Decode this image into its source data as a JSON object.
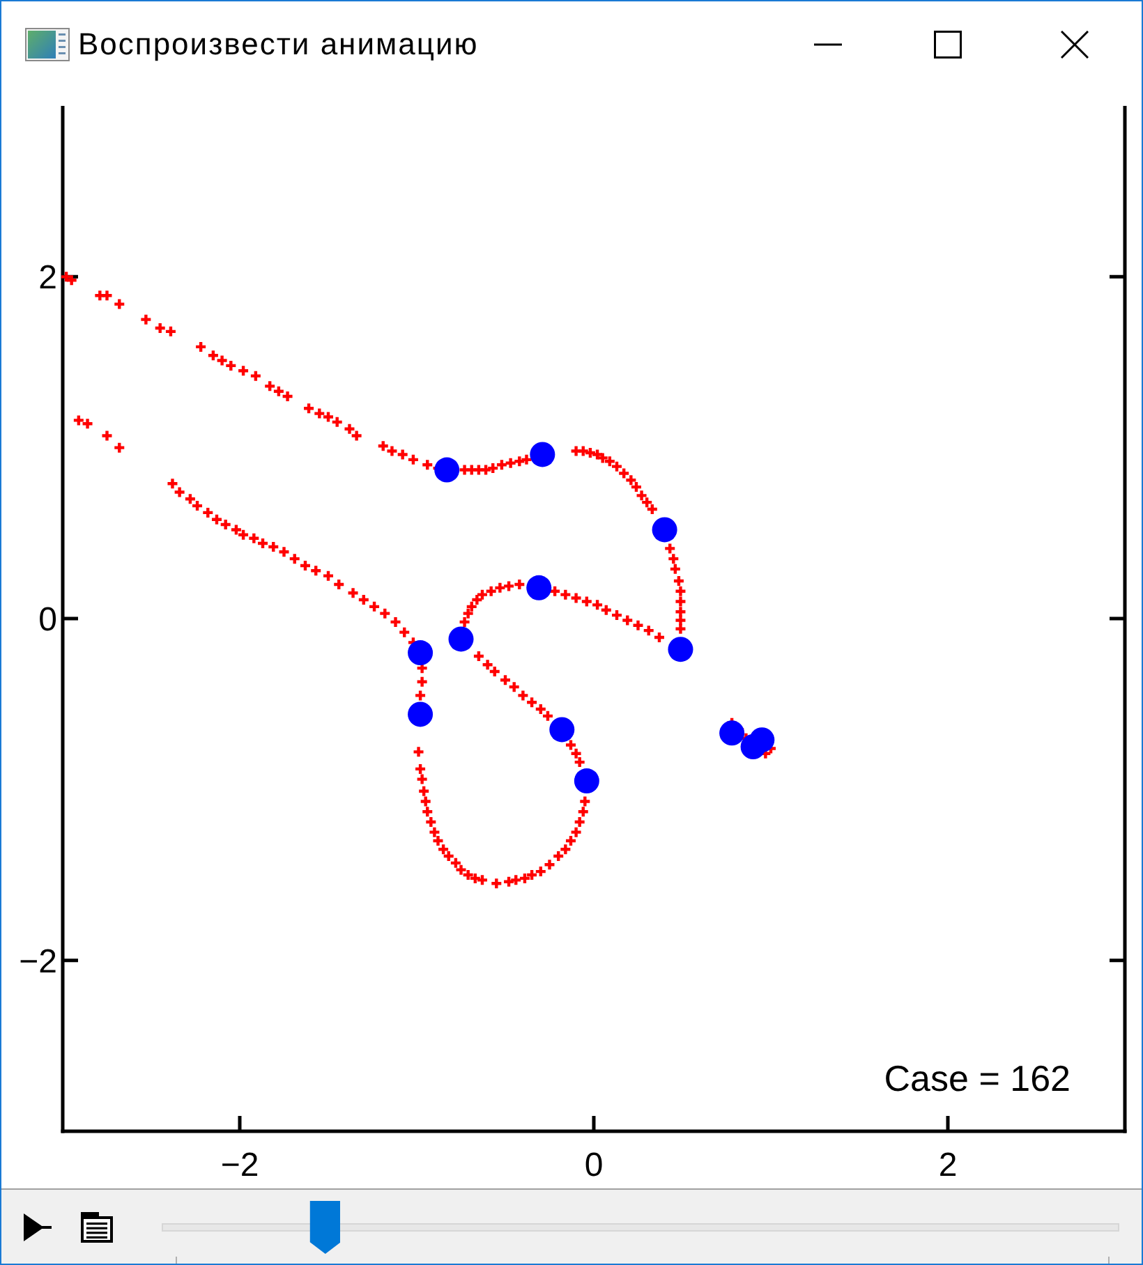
{
  "window": {
    "title": "Воспроизвести анимацию"
  },
  "plot": {
    "chart_data": {
      "type": "scatter",
      "xlim": [
        -3,
        3
      ],
      "ylim": [
        -3,
        3
      ],
      "xticks": [
        {
          "value": -2,
          "label": "−2"
        },
        {
          "value": 0,
          "label": "0"
        },
        {
          "value": 2,
          "label": "2"
        }
      ],
      "yticks": [
        {
          "value": -2,
          "label": "−2"
        },
        {
          "value": 0,
          "label": "0"
        },
        {
          "value": 2,
          "label": "2"
        }
      ],
      "series": [
        {
          "marker": "cross",
          "color": "#ff0000",
          "x": [
            -2.98,
            -2.95,
            -2.79,
            -2.75,
            -2.68,
            -2.53,
            -2.45,
            -2.39,
            -2.22,
            -2.15,
            -2.1,
            -2.05,
            -1.98,
            -1.91,
            -1.83,
            -1.78,
            -1.73,
            -1.61,
            -1.55,
            -1.5,
            -1.45,
            -1.38,
            -1.34,
            -1.19,
            -1.14,
            -1.08,
            -1.02,
            -0.94,
            -0.88,
            -0.73,
            -0.69,
            -0.65,
            -0.61,
            -0.57,
            -0.52,
            -0.47,
            -0.42,
            -0.38,
            -0.1,
            -0.06,
            -0.02,
            0.02,
            0.05,
            0.09,
            0.13,
            0.17,
            0.21,
            0.24,
            0.27,
            0.3,
            0.33,
            0.43,
            0.45,
            0.46,
            0.48,
            0.49,
            0.49,
            0.49,
            0.49,
            0.49,
            0.37,
            0.31,
            0.25,
            0.19,
            0.13,
            0.07,
            0.02,
            -0.04,
            -0.1,
            -0.16,
            -0.22,
            -0.42,
            -0.48,
            -0.53,
            -0.58,
            -0.63,
            -0.66,
            -0.69,
            -0.71,
            -0.73,
            -0.65,
            -0.6,
            -0.56,
            -0.5,
            -0.45,
            -0.4,
            -0.35,
            -0.3,
            -0.26,
            -0.13,
            -0.1,
            -0.08,
            -0.05,
            -0.06,
            -0.08,
            -0.1,
            -0.13,
            -0.16,
            -0.2,
            -0.25,
            -0.3,
            -0.35,
            -0.39,
            -0.44,
            -0.48,
            -0.55,
            -0.63,
            -0.67,
            -0.71,
            -0.75,
            -0.78,
            -0.82,
            -0.85,
            -0.88,
            -0.9,
            -0.92,
            -0.94,
            -0.95,
            -0.96,
            -0.97,
            -0.98,
            -0.99,
            -0.98,
            -0.97,
            -0.97,
            -1.02,
            -1.07,
            -1.12,
            -1.18,
            -1.24,
            -1.3,
            -1.36,
            -1.44,
            -1.5,
            -1.57,
            -1.63,
            -1.69,
            -1.75,
            -1.81,
            -1.87,
            -1.92,
            -1.98,
            -2.02,
            -2.08,
            -2.13,
            -2.18,
            -2.24,
            -2.28,
            -2.34,
            -2.38,
            -2.68,
            -2.75,
            -2.86,
            -2.91,
            0.78,
            0.82,
            0.86,
            0.97,
            1.0
          ],
          "values": [
            2.0,
            1.98,
            1.89,
            1.89,
            1.84,
            1.75,
            1.7,
            1.68,
            1.59,
            1.54,
            1.51,
            1.48,
            1.45,
            1.42,
            1.36,
            1.33,
            1.3,
            1.23,
            1.2,
            1.18,
            1.15,
            1.11,
            1.07,
            1.01,
            0.98,
            0.96,
            0.93,
            0.9,
            0.88,
            0.87,
            0.87,
            0.87,
            0.87,
            0.88,
            0.9,
            0.91,
            0.92,
            0.93,
            0.98,
            0.98,
            0.97,
            0.96,
            0.94,
            0.92,
            0.89,
            0.85,
            0.81,
            0.77,
            0.72,
            0.68,
            0.64,
            0.41,
            0.35,
            0.29,
            0.22,
            0.16,
            0.1,
            0.04,
            -0.01,
            -0.06,
            -0.11,
            -0.07,
            -0.04,
            -0.01,
            0.02,
            0.05,
            0.08,
            0.1,
            0.12,
            0.14,
            0.16,
            0.2,
            0.19,
            0.18,
            0.16,
            0.14,
            0.11,
            0.07,
            0.03,
            -0.02,
            -0.22,
            -0.27,
            -0.31,
            -0.36,
            -0.4,
            -0.45,
            -0.49,
            -0.53,
            -0.57,
            -0.74,
            -0.79,
            -0.84,
            -1.07,
            -1.13,
            -1.19,
            -1.25,
            -1.3,
            -1.35,
            -1.39,
            -1.44,
            -1.48,
            -1.5,
            -1.52,
            -1.53,
            -1.54,
            -1.55,
            -1.53,
            -1.52,
            -1.5,
            -1.47,
            -1.43,
            -1.39,
            -1.35,
            -1.3,
            -1.25,
            -1.19,
            -1.13,
            -1.07,
            -1.01,
            -0.94,
            -0.88,
            -0.78,
            -0.45,
            -0.37,
            -0.29,
            -0.14,
            -0.08,
            -0.02,
            0.03,
            0.07,
            0.11,
            0.15,
            0.2,
            0.25,
            0.28,
            0.31,
            0.35,
            0.39,
            0.42,
            0.44,
            0.47,
            0.49,
            0.52,
            0.55,
            0.58,
            0.62,
            0.66,
            0.7,
            0.74,
            0.79,
            1.0,
            1.07,
            1.14,
            1.16,
            -0.61,
            -0.65,
            -0.7,
            -0.79,
            -0.76
          ]
        },
        {
          "marker": "dot",
          "color": "#0000ff",
          "x": [
            -0.83,
            -0.29,
            0.4,
            -0.31,
            -0.75,
            -0.98,
            0.49,
            -0.98,
            -0.18,
            -0.04,
            0.78,
            0.9,
            0.95
          ],
          "values": [
            0.87,
            0.96,
            0.52,
            0.18,
            -0.12,
            -0.2,
            -0.18,
            -0.56,
            -0.65,
            -0.95,
            -0.67,
            -0.75,
            -0.71
          ]
        }
      ],
      "annotations": [
        {
          "text": "Case = 162"
        }
      ]
    }
  },
  "toolbar": {
    "slider": {
      "level": 0.16
    }
  }
}
